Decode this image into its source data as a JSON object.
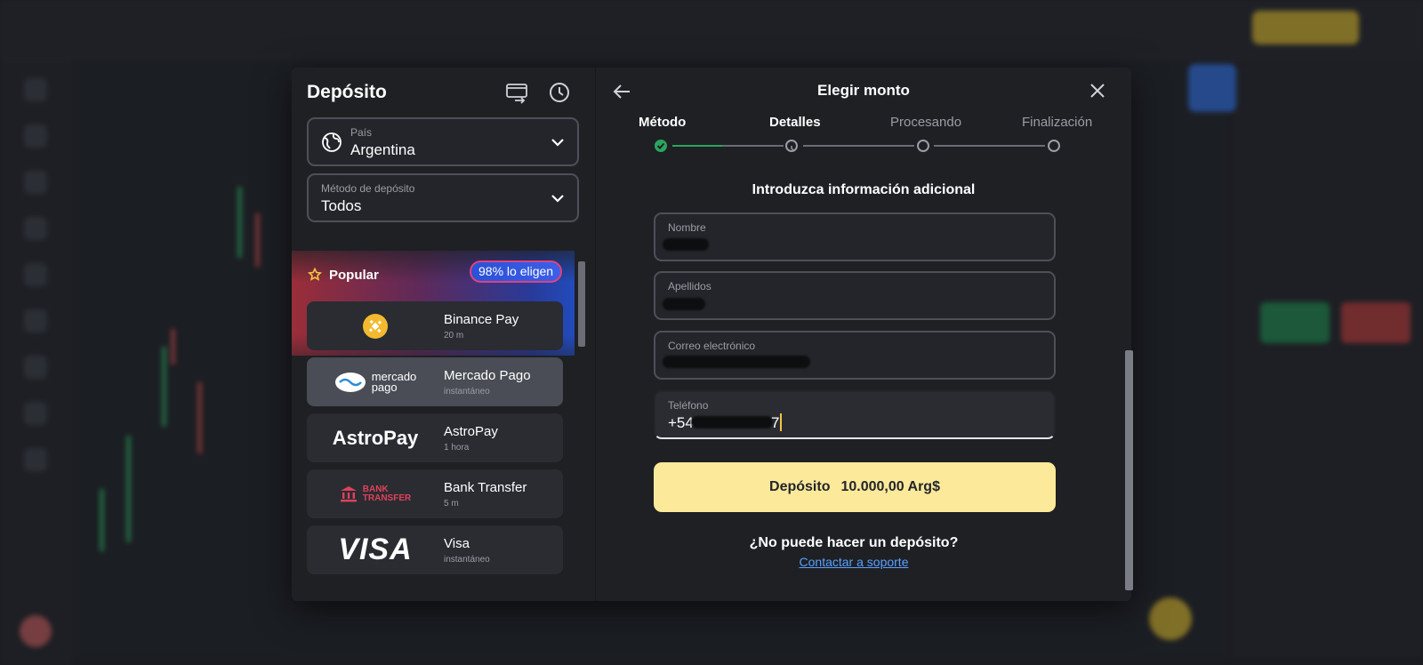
{
  "deposit_panel": {
    "title": "Depósito",
    "country": {
      "label": "País",
      "value": "Argentina"
    },
    "method": {
      "label": "Método de depósito",
      "value": "Todos"
    },
    "popular": {
      "label": "Popular",
      "badge": "98% lo eligen"
    },
    "methods": [
      {
        "name": "Binance Pay",
        "time": "20 m",
        "icon": "binance-icon"
      },
      {
        "name": "Mercado Pago",
        "time": "instantáneo",
        "icon": "mercado-pago-icon",
        "logo_line1": "mercado",
        "logo_line2": "pago"
      },
      {
        "name": "AstroPay",
        "time": "1 hora",
        "icon": "astropay-icon",
        "logo": "AstroPay"
      },
      {
        "name": "Bank Transfer",
        "time": "5 m",
        "icon": "bank-transfer-icon",
        "logo_line1": "BANK",
        "logo_line2": "TRANSFER"
      },
      {
        "name": "Visa",
        "time": "instantáneo",
        "icon": "visa-icon",
        "logo": "VISA"
      }
    ]
  },
  "amount_panel": {
    "title": "Elegir monto",
    "steps": [
      {
        "label": "Método",
        "state": "done"
      },
      {
        "label": "Detalles",
        "state": "current"
      },
      {
        "label": "Procesando",
        "state": "todo"
      },
      {
        "label": "Finalización",
        "state": "todo"
      }
    ],
    "subtitle": "Introduzca información adicional",
    "fields": {
      "first_name": {
        "label": "Nombre",
        "value": ""
      },
      "last_name": {
        "label": "Apellidos",
        "value": ""
      },
      "email": {
        "label": "Correo electrónico",
        "value": ""
      },
      "phone": {
        "label": "Teléfono",
        "prefix": "+54",
        "suffix": "7"
      }
    },
    "deposit_button": {
      "label": "Depósito",
      "amount": "10.000,00 Arg$"
    },
    "help_question": "¿No puede hacer un depósito?",
    "support_link": "Contactar a soporte"
  },
  "colors": {
    "accent_yellow": "#fde99a",
    "success_green": "#2aa55f",
    "link_blue": "#5aa0ff",
    "badge_border": "#e0417a"
  }
}
